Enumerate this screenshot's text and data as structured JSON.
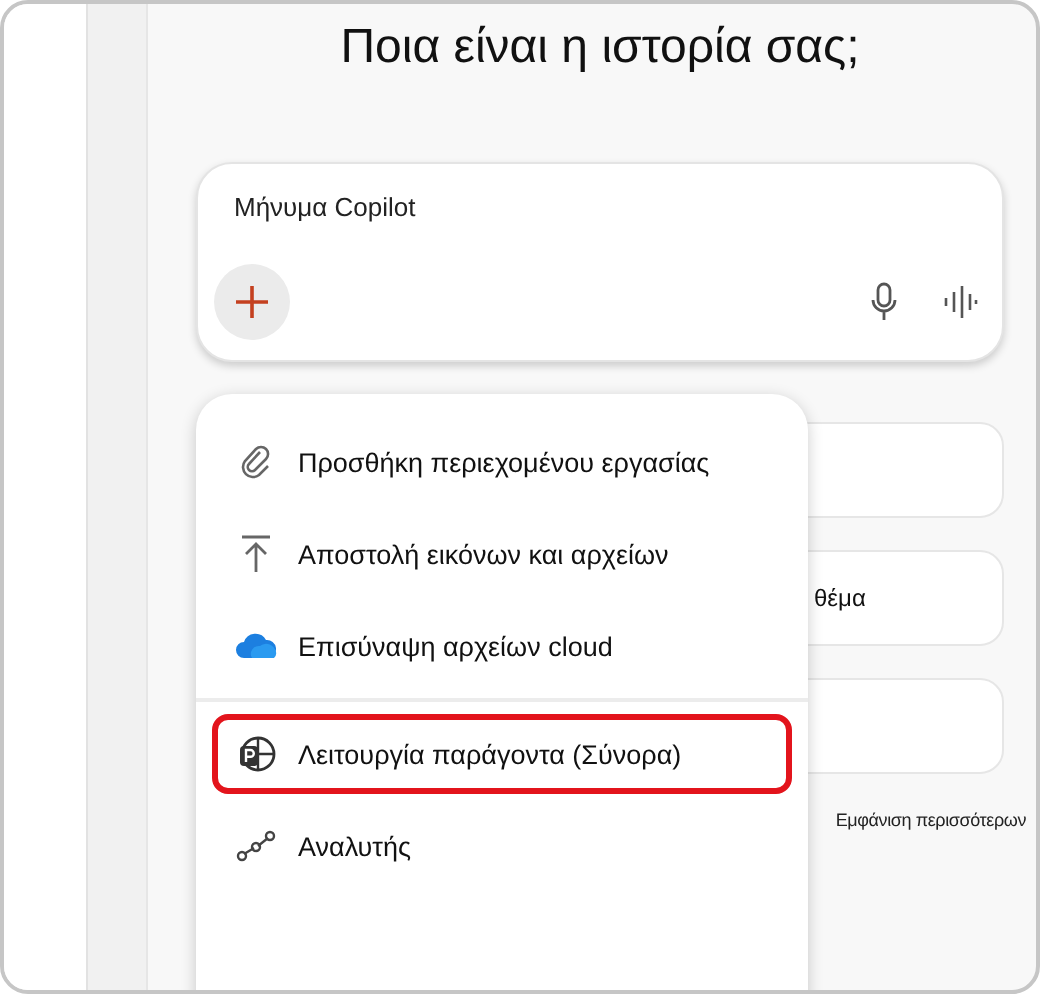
{
  "heading": "Ποια είναι η ιστορία σας;",
  "composer": {
    "placeholder": "Μήνυμα Copilot"
  },
  "suggestions": [
    {
      "kind": "blank"
    },
    {
      "kind": "text",
      "text": "θέμα"
    },
    {
      "kind": "blank"
    }
  ],
  "show_more": "Εμφάνιση περισσότερων",
  "menu": [
    {
      "kind": "clip",
      "label": "Προσθήκη περιεχομένου εργασίας",
      "highlighted": false,
      "divider_before": false
    },
    {
      "kind": "upload",
      "label": "Αποστολή εικόνων και αρχείων",
      "highlighted": false,
      "divider_before": false
    },
    {
      "kind": "cloud",
      "label": "Επισύναψη αρχείων cloud",
      "highlighted": false,
      "divider_before": false
    },
    {
      "kind": "agent",
      "label": "Λειτουργία παράγοντα (Σύνορα)",
      "highlighted": true,
      "divider_before": true
    },
    {
      "kind": "analyst",
      "label": "Αναλυτής",
      "highlighted": false,
      "divider_before": false
    }
  ]
}
